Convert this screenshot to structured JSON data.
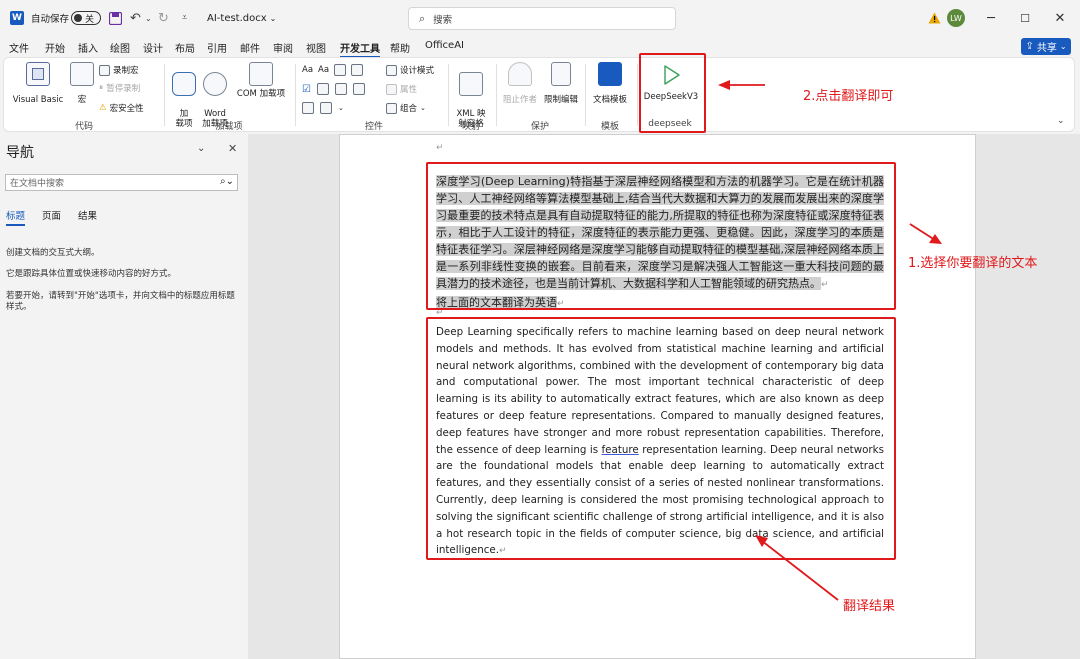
{
  "titlebar": {
    "autosave_label": "自动保存",
    "autosave_state": "关",
    "filename": "AI-test.docx",
    "search_placeholder": "搜索",
    "avatar_initials": "LW"
  },
  "menu": {
    "tabs": [
      "文件",
      "开始",
      "插入",
      "绘图",
      "设计",
      "布局",
      "引用",
      "邮件",
      "审阅",
      "视图",
      "开发工具",
      "帮助",
      "OfficeAI"
    ],
    "active_tab": "开发工具",
    "share_label": "共享"
  },
  "ribbon": {
    "code": {
      "label": "代码",
      "visual_basic": "Visual Basic",
      "macros": "宏",
      "record_macro": "录制宏",
      "pause_recording": "暂停录制",
      "macro_security": "宏安全性"
    },
    "addins": {
      "label": "加载项",
      "addins": "加\n载项",
      "word_addins": "Word\n加载项",
      "com_addins": "COM 加载项"
    },
    "controls": {
      "label": "控件",
      "design_mode": "设计模式",
      "properties": "属性",
      "group": "组合"
    },
    "mapping": {
      "label": "映射",
      "xml_mapping": "XML 映\n射窗格"
    },
    "protect": {
      "label": "保护",
      "block_authors": "阻止作者",
      "restrict_editing": "限制编辑"
    },
    "templates": {
      "label": "模板",
      "document_template": "文档模板"
    },
    "deepseek": {
      "label": "deepseek",
      "button": "DeepSeekV3"
    }
  },
  "navpane": {
    "title": "导航",
    "search_placeholder": "在文档中搜索",
    "tabs": [
      "标题",
      "页面",
      "结果"
    ],
    "line1": "创建文档的交互式大纲。",
    "line2": "它是跟踪具体位置或快速移动内容的好方式。",
    "line3": "若要开始，请转到\"开始\"选项卡，并向文档中的标题应用标题样式。"
  },
  "document": {
    "zh_text": "深度学习(Deep Learning)特指基于深层神经网络模型和方法的机器学习。它是在统计机器学习、人工神经网络等算法模型基础上,结合当代大数据和大算力的发展而发展出来的深度学习最重要的技术特点是具有自动提取特征的能力,所提取的特征也称为深度特征或深度特征表示，相比于人工设计的特征，深度特征的表示能力更强、更稳健。因此，深度学习的本质是特征表征学习。深层神经网络是深度学习能够自动提取特征的模型基础,深层神经网络本质上是一系列非线性变换的嵌套。目前看来，深度学习是解决强人工智能这一重大科技问题的最具潜力的技术途径，也是当前计算机、大数据科学和人工智能领域的研究热点。",
    "zh_instruction": "将上面的文本翻译为英语",
    "en_text_1": "Deep Learning specifically refers to machine learning based on deep neural network models and methods. It has evolved from statistical machine learning and artificial neural network algorithms, combined with the development of contemporary big data and computational power. The most important technical characteristic of deep learning is its ability to automatically extract features, which are also known as deep features or deep feature representations. Compared to manually designed features, deep features have stronger and more robust representation capabilities. Therefore, the essence of deep learning is ",
    "en_underlined": "feature",
    "en_text_2": " representation learning. Deep neural networks are the foundational models that enable deep learning to automatically extract features, and they essentially consist of a series of nested nonlinear transformations. Currently, deep learning is considered the most promising technological approach to solving the significant scientific challenge of strong artificial intelligence, and it is also a hot research topic in the fields of computer science, big data science, and artificial intelligence."
  },
  "annotations": {
    "step2": "2.点击翻译即可",
    "step1": "1.选择你要翻译的文本",
    "result": "翻译结果",
    "color": "#e0191b"
  }
}
